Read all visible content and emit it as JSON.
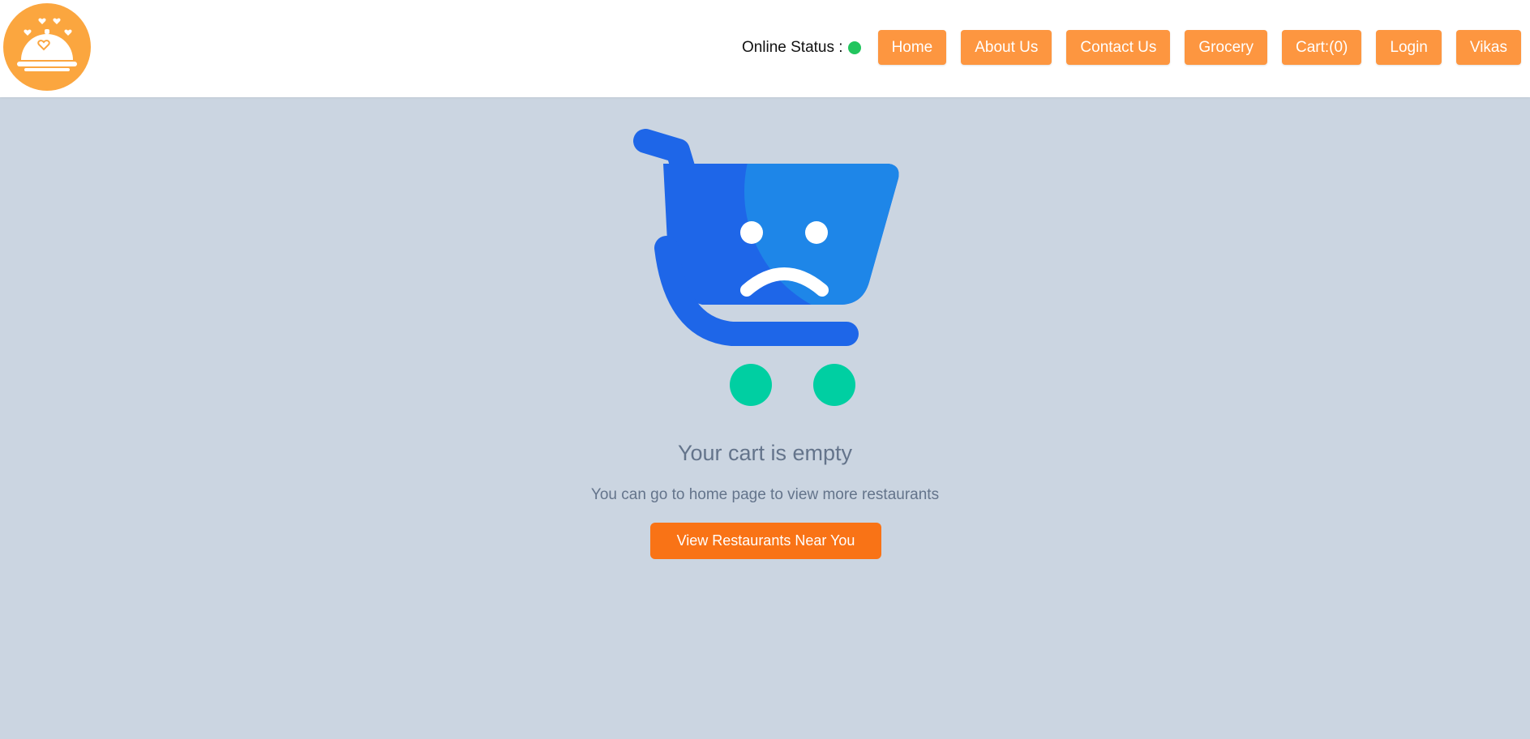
{
  "header": {
    "logo_icon": "food-cloche-icon",
    "online_status_label": "Online Status :",
    "online_status_color": "#22c55e",
    "nav": [
      {
        "name": "nav-home-button",
        "label": "Home"
      },
      {
        "name": "nav-about-button",
        "label": "About Us"
      },
      {
        "name": "nav-contact-button",
        "label": "Contact Us"
      },
      {
        "name": "nav-grocery-button",
        "label": "Grocery"
      },
      {
        "name": "nav-cart-button",
        "label": "Cart:(0)"
      },
      {
        "name": "nav-login-button",
        "label": "Login"
      },
      {
        "name": "nav-user-button",
        "label": "Vikas"
      }
    ]
  },
  "main": {
    "illustration_icon": "sad-cart-icon",
    "title": "Your cart is empty",
    "subtitle": "You can go to home page to view more restaurants",
    "cta_label": "View Restaurants Near You"
  },
  "colors": {
    "accent": "#fd9640",
    "cta": "#f97316",
    "background": "#cbd5e1",
    "cart_blue": "#1e66e8",
    "wheels": "#00cfa2"
  }
}
